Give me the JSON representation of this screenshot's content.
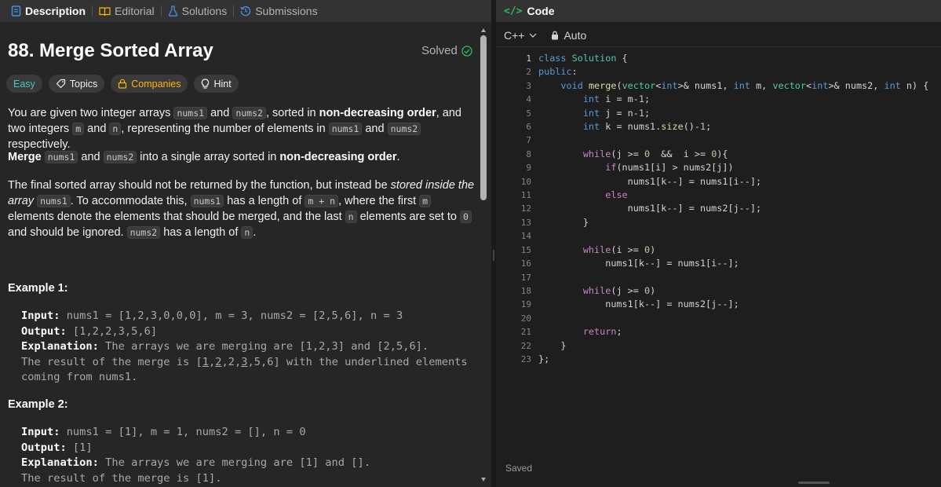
{
  "tabs": {
    "description": "Description",
    "editorial": "Editorial",
    "solutions": "Solutions",
    "submissions": "Submissions"
  },
  "problem": {
    "title": "88. Merge Sorted Array",
    "status": "Solved",
    "difficulty": "Easy",
    "topics": "Topics",
    "companies": "Companies",
    "hint": "Hint"
  },
  "colors": {
    "easy": "#46c6c2",
    "companies": "#ffb800",
    "solved_check": "#2cbb5d",
    "code_icon": "#2cbb5d"
  },
  "description": {
    "p1": {
      "t1": "You are given two integer arrays ",
      "c1": "nums1",
      "t2": " and ",
      "c2": "nums2",
      "t3": ", sorted in ",
      "b1": "non-decreasing order",
      "t4": ", and two integers ",
      "c3": "m",
      "t5": " and ",
      "c4": "n",
      "t6": ", representing the number of elements in ",
      "c5": "nums1",
      "t7": " and ",
      "c6": "nums2",
      "t8": " respectively."
    },
    "p2": {
      "b1": "Merge",
      "c1": "nums1",
      "t1": " and ",
      "c2": "nums2",
      "t2": " into a single array sorted in ",
      "b2": "non-decreasing order",
      "t3": "."
    },
    "p3": {
      "t1": "The final sorted array should not be returned by the function, but instead be ",
      "i1": "stored inside the array ",
      "c1": "nums1",
      "t2": ". To accommodate this, ",
      "c2": "nums1",
      "t3": " has a length of ",
      "c3": "m + n",
      "t4": ", where the first ",
      "c4": "m",
      "t5": " elements denote the elements that should be merged, and the last ",
      "c5": "n",
      "t6": " elements are set to ",
      "c6": "0",
      "t7": " and should be ignored. ",
      "c7": "nums2",
      "t8": " has a length of ",
      "c8": "n",
      "t9": "."
    }
  },
  "examples": [
    {
      "heading": "Example 1:",
      "input_label": "Input:",
      "input": " nums1 = [1,2,3,0,0,0], m = 3, nums2 = [2,5,6], n = 3",
      "output_label": "Output:",
      "output": " [1,2,2,3,5,6]",
      "explanation_label": "Explanation:",
      "explanation": " The arrays we are merging are [1,2,3] and [2,5,6].",
      "result_pre": "The result of the merge is [",
      "result_u1": "1",
      "result_s1": ",",
      "result_u2": "2",
      "result_s2": ",2,",
      "result_u3": "3",
      "result_s3": ",5,6] with the underlined elements",
      "result_line2": "coming from nums1."
    },
    {
      "heading": "Example 2:",
      "input_label": "Input:",
      "input": " nums1 = [1], m = 1, nums2 = [], n = 0",
      "output_label": "Output:",
      "output": " [1]",
      "explanation_label": "Explanation:",
      "explanation": " The arrays we are merging are [1] and [].",
      "result_line": "The result of the merge is [1]."
    }
  ],
  "editor": {
    "header": "Code",
    "language": "C++",
    "mode": "Auto",
    "status": "Saved",
    "line_numbers": [
      "1",
      "2",
      "3",
      "4",
      "5",
      "6",
      "7",
      "8",
      "9",
      "10",
      "11",
      "12",
      "13",
      "14",
      "15",
      "16",
      "17",
      "18",
      "19",
      "20",
      "21",
      "22",
      "23"
    ],
    "code": [
      "class Solution {",
      "public:",
      "    void merge(vector<int>& nums1, int m, vector<int>& nums2, int n) {",
      "        int i = m-1;",
      "        int j = n-1;",
      "        int k = nums1.size()-1;",
      "",
      "        while(j >= 0  &&  i >= 0){",
      "            if(nums1[i] > nums2[j])",
      "                nums1[k--] = nums1[i--];",
      "            else",
      "                nums1[k--] = nums2[j--];",
      "        }",
      "",
      "        while(i >= 0)",
      "            nums1[k--] = nums1[i--];",
      "",
      "        while(j >= 0)",
      "            nums1[k--] = nums2[j--];",
      "",
      "        return;",
      "    }",
      "};"
    ]
  }
}
